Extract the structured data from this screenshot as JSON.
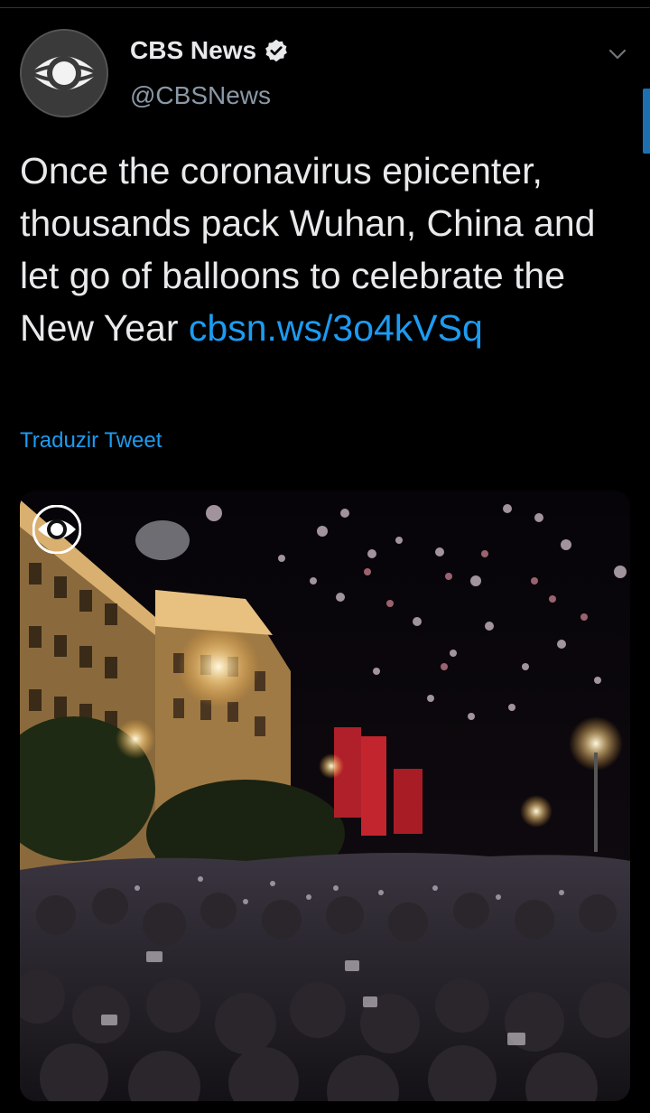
{
  "tweet": {
    "author": {
      "display_name": "CBS News",
      "handle": "@CBSNews",
      "verified": true,
      "avatar_icon": "cbs-eye-logo-icon"
    },
    "text": "Once the coronavirus epicenter, thousands pack Wuhan, China and let go of balloons to celebrate the New Year ",
    "link_text": "cbsn.ws/3o4kVSq",
    "translate_label": "Traduzir Tweet",
    "media": {
      "type": "video-thumbnail",
      "watermark_icon": "cbs-eye-logo-icon"
    }
  },
  "ui": {
    "menu_icon": "chevron-down-icon",
    "colors": {
      "background": "#000000",
      "text": "#e7e9ea",
      "secondary_text": "#8b98a5",
      "link": "#1d9bf0",
      "scroll_indicator": "#1d6fb0"
    }
  }
}
